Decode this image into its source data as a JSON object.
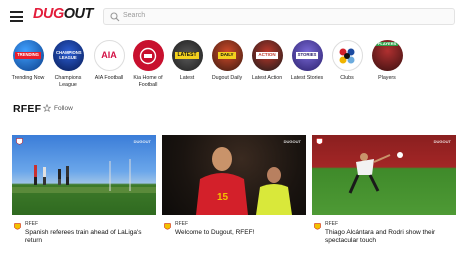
{
  "header": {
    "logo_part1": "DUG",
    "logo_part2": "OUT",
    "search_placeholder": "Search"
  },
  "channels": [
    {
      "label": "Trending Now",
      "badge": "TRENDING",
      "color": "#1c6fd0"
    },
    {
      "label": "Champions League",
      "badge": "CHAMPIONS LEAGUE",
      "color": "#0b2a7a"
    },
    {
      "label": "AIA Football",
      "badge": "AIA",
      "color": "#ffffff"
    },
    {
      "label": "Kia Home of Football",
      "badge": "",
      "color": "#c8102e"
    },
    {
      "label": "Latest",
      "badge": "LATEST",
      "color": "#2a2a2a"
    },
    {
      "label": "Dugout Daily",
      "badge": "DAILY",
      "color": "#6b2b1a"
    },
    {
      "label": "Latest Action",
      "badge": "ACTION",
      "color": "#2a2a2a"
    },
    {
      "label": "Latest Stories",
      "badge": "STORIES",
      "color": "#4a3aa8"
    },
    {
      "label": "Clubs",
      "badge": "",
      "color": "#ffffff"
    },
    {
      "label": "Players",
      "badge": "PLAYERS",
      "color": "#2fa04a"
    }
  ],
  "page": {
    "title": "RFEF",
    "follow_label": "Follow"
  },
  "cards": [
    {
      "channel": "RFEF",
      "title": "Spanish referees train ahead of LaLiga's return",
      "watermark": "DUGOUT"
    },
    {
      "channel": "RFEF",
      "title": "Welcome to Dugout, RFEF!",
      "watermark": "DUGOUT"
    },
    {
      "channel": "RFEF",
      "title": "Thiago Alcántara and Rodri show their spectacular touch",
      "watermark": "DUGOUT"
    }
  ]
}
